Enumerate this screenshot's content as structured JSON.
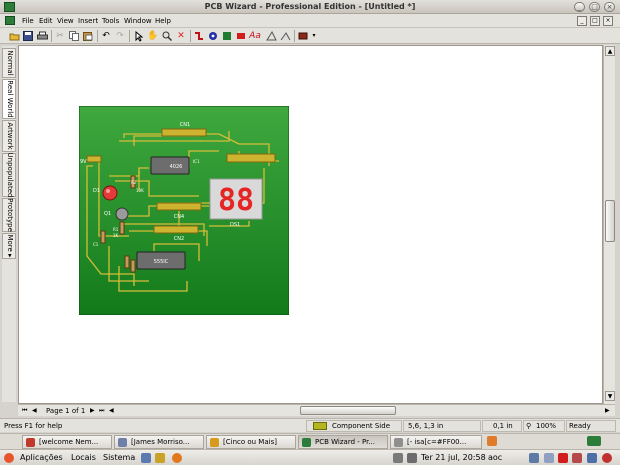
{
  "window": {
    "title": "PCB Wizard - Professional Edition - [Untitled *]",
    "controls": [
      "_",
      "□",
      "×"
    ]
  },
  "menubar": {
    "items": [
      "File",
      "Edit",
      "View",
      "Insert",
      "Tools",
      "Window",
      "Help"
    ],
    "mdi_controls": [
      "_",
      "□",
      "×"
    ]
  },
  "side_tabs": [
    "Normal",
    "Real World",
    "Artwork",
    "Unpopulated",
    "Prototype",
    "More ▸"
  ],
  "pcb": {
    "labels": {
      "cn1": "CN1",
      "cn2": "CN2",
      "cn4": "CN4",
      "bat": "9V",
      "d1": "D1",
      "q1": "Q1",
      "r1": "R1",
      "r1v": "1K",
      "r2": "R2",
      "r2v": "10K",
      "ic1": "IC1",
      "ic1chip": "4026",
      "ic2chip": "555IC",
      "dsp": "DS1",
      "c1": "C1"
    },
    "display_text": "88",
    "colors": {
      "board_top": "#3fa83e",
      "board_bottom": "#137a1b",
      "track": "#d6bd3a",
      "display": "#e52424"
    }
  },
  "hscroll": {
    "page_label": "Page 1 of 1"
  },
  "status": {
    "help": "Press F1 for help",
    "layer": "Component Side",
    "layer_color": "#b5b61f",
    "coords": "5,6, 1,3 in",
    "grid": "0,1 in",
    "zoom": "100%",
    "state": "Ready"
  },
  "taskbar": {
    "tasks": [
      {
        "label": "[welcome Nem...",
        "color": "#c0392b"
      },
      {
        "label": "[James Morriso...",
        "color": "#6f7fa8"
      },
      {
        "label": "[Cinco ou Mais]",
        "color": "#d79a1a"
      },
      {
        "label": "PCB Wizard - Pr...",
        "color": "#2c7d3a"
      },
      {
        "label": "[- isa[c=#FF00...",
        "color": "#8f8f8f"
      }
    ]
  },
  "panel": {
    "menus": [
      "Aplicações",
      "Locais",
      "Sistema"
    ],
    "clock": "Ter 21 jul, 20:58",
    "keyboard": "aoc"
  }
}
